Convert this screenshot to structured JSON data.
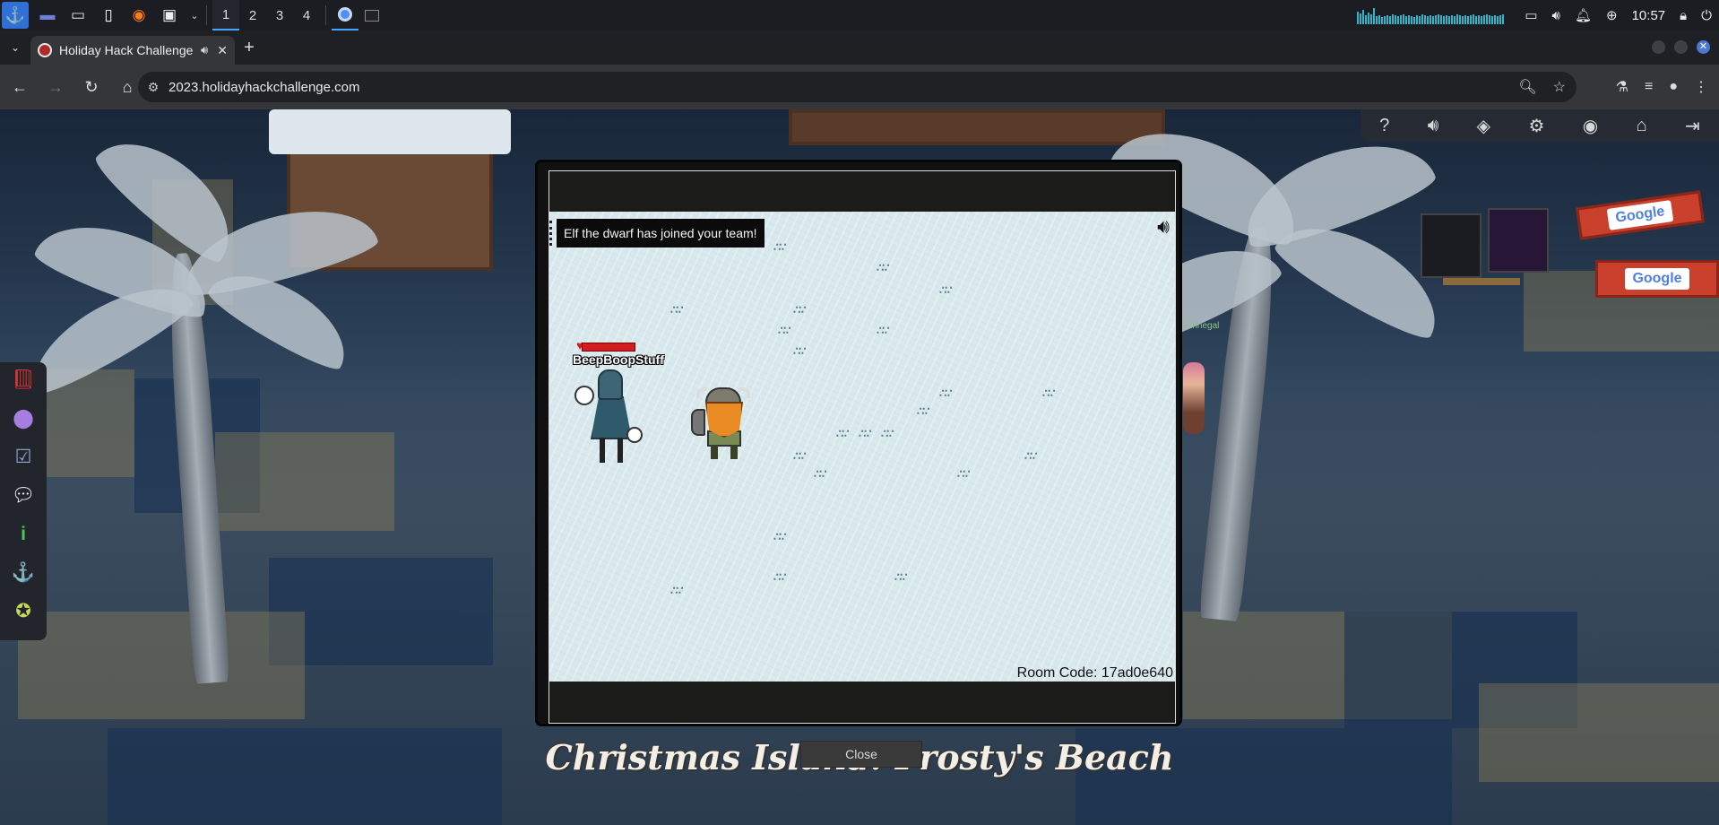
{
  "os_panel": {
    "workspaces": [
      "1",
      "2",
      "3",
      "4"
    ],
    "active_workspace": "1",
    "clock": "10:57",
    "accent_color": "#4aa3ff"
  },
  "browser": {
    "tab": {
      "title": "Holiday Hack Challenge",
      "audio_icon": "speaker-icon",
      "favicon_color": "#b02a2a"
    },
    "url": "2023.holidayhackchallenge.com"
  },
  "game": {
    "location_title": "Christmas Island: Frosty's Beach",
    "google_sign_top": "Google",
    "google_sign_bottom": "Google",
    "npc_label": "Finnegal",
    "right_toolbar_icons": [
      "help-icon",
      "volume-icon",
      "discord-icon",
      "gear-icon",
      "user-icon",
      "home-icon",
      "logout-icon"
    ],
    "sidebar_icons": [
      {
        "name": "book-icon",
        "color": "#e0332f"
      },
      {
        "name": "map-pin-icon",
        "color": "#a77ee0"
      },
      {
        "name": "checklist-icon",
        "color": "#8fa6d6"
      },
      {
        "name": "chat-icon",
        "color": "#ffffff"
      },
      {
        "name": "info-icon",
        "color": "#4cc65a"
      },
      {
        "name": "anchor-icon",
        "color": "#e9a12a"
      },
      {
        "name": "badge-icon",
        "color": "#c9d657"
      }
    ]
  },
  "modal": {
    "toast": "Elf the dwarf has joined your team!",
    "player_name": "BeepBoopStuff",
    "room_code": "Room Code: 17ad0e640",
    "close_label": "Close"
  }
}
